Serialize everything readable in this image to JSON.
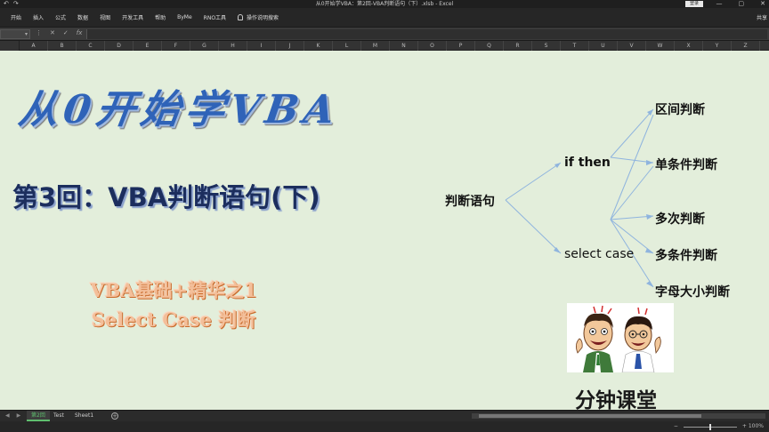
{
  "window": {
    "title": "从0开始学VBA：第2回-VBA判断语句（下）.xlsb - Excel",
    "login_label": "登录",
    "controls": [
      "—",
      "▢",
      "✕"
    ]
  },
  "ribbon": {
    "tabs": [
      "开始",
      "插入",
      "公式",
      "数据",
      "视图",
      "开发工具",
      "帮助",
      "ByMe",
      "RNO工具"
    ],
    "tell_me": "操作说明搜索",
    "share": "共享"
  },
  "formula_bar": {
    "name_box": "",
    "icons": [
      "⋮",
      "✕",
      "✓",
      "fx"
    ],
    "value": ""
  },
  "columns": [
    "A",
    "B",
    "C",
    "D",
    "E",
    "F",
    "G",
    "H",
    "I",
    "J",
    "K",
    "L",
    "M",
    "N",
    "O",
    "P",
    "Q",
    "R",
    "S",
    "T",
    "U",
    "V",
    "W",
    "X",
    "Y",
    "Z"
  ],
  "slide": {
    "big_title": "从0开始学VBA",
    "subtitle": "第3回：VBA判断语句(下)",
    "promo_line1": "VBA基础+精华之1",
    "promo_line2": "Select Case 判断",
    "brand": "分钟课堂"
  },
  "mindmap": {
    "root": "判断语句",
    "branches": [
      "if then",
      "select case"
    ],
    "leaves": [
      "区间判断",
      "单条件判断",
      "多次判断",
      "多条件判断",
      "字母大小判断"
    ]
  },
  "sheet_tabs": {
    "tabs": [
      "第2回",
      "Test",
      "Sheet1"
    ],
    "active_index": 0
  },
  "status": {
    "zoom": "+ 100%"
  }
}
